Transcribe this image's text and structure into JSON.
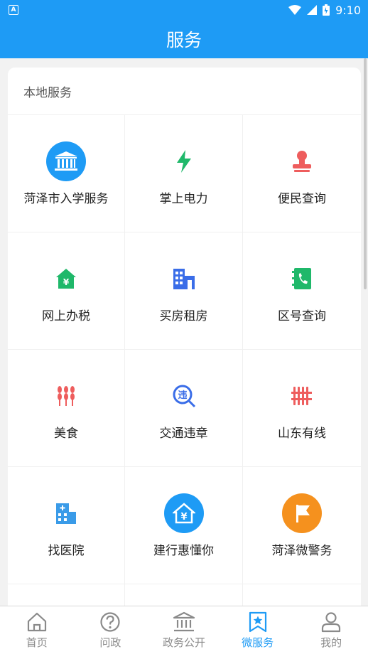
{
  "status_bar": {
    "time": "9:10",
    "left_glyph": "A"
  },
  "header": {
    "title": "服务"
  },
  "section": {
    "title": "本地服务"
  },
  "services": [
    {
      "label": "菏泽市入学服务",
      "icon": "bank-icon"
    },
    {
      "label": "掌上电力",
      "icon": "lightning-icon"
    },
    {
      "label": "便民查询",
      "icon": "stamp-icon"
    },
    {
      "label": "网上办税",
      "icon": "tax-house-icon"
    },
    {
      "label": "买房租房",
      "icon": "building-icon"
    },
    {
      "label": "区号查询",
      "icon": "phone-book-icon"
    },
    {
      "label": "美食",
      "icon": "wheat-icon"
    },
    {
      "label": "交通违章",
      "icon": "traffic-violation-icon"
    },
    {
      "label": "山东有线",
      "icon": "cable-icon"
    },
    {
      "label": "找医院",
      "icon": "hospital-icon"
    },
    {
      "label": "建行惠懂你",
      "icon": "ccb-house-icon"
    },
    {
      "label": "菏泽微警务",
      "icon": "flag-icon"
    }
  ],
  "tabs": [
    {
      "label": "首页",
      "icon": "home-icon",
      "active": false
    },
    {
      "label": "问政",
      "icon": "question-icon",
      "active": false
    },
    {
      "label": "政务公开",
      "icon": "government-icon",
      "active": false
    },
    {
      "label": "微服务",
      "icon": "star-bookmark-icon",
      "active": true
    },
    {
      "label": "我的",
      "icon": "user-icon",
      "active": false
    }
  ],
  "colors": {
    "brand": "#1e9bf5",
    "tab_inactive": "#8a8a8a"
  }
}
